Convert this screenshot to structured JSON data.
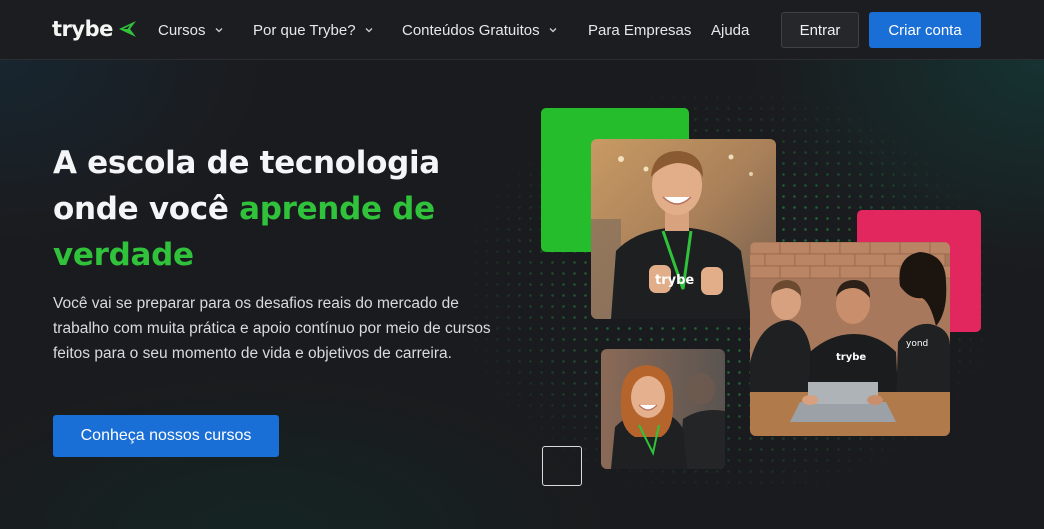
{
  "brand": {
    "name": "trybe",
    "accent": "#2fc23a",
    "primary_button": "#1a6fd6"
  },
  "nav": {
    "items": [
      {
        "label": "Cursos",
        "has_dropdown": true
      },
      {
        "label": "Por que Trybe?",
        "has_dropdown": true
      },
      {
        "label": "Conteúdos Gratuitos",
        "has_dropdown": true
      },
      {
        "label": "Para Empresas",
        "has_dropdown": false
      },
      {
        "label": "Ajuda",
        "has_dropdown": false
      }
    ],
    "login_label": "Entrar",
    "signup_label": "Criar conta"
  },
  "hero": {
    "headline_part1": "A escola de tecnologia onde você ",
    "headline_highlight": "aprende de verdade",
    "description": "Você vai se preparar para os desafios reais do mercado de trabalho com muita prática e apoio contínuo por meio de cursos feitos para o seu momento de vida e objetivos de carreira.",
    "cta_label": "Conheça nossos cursos"
  },
  "photos": {
    "photo1_shirt_text": "trybe",
    "photo2_shirt_text_1": "trybe",
    "photo2_shirt_text_2": "yond"
  }
}
